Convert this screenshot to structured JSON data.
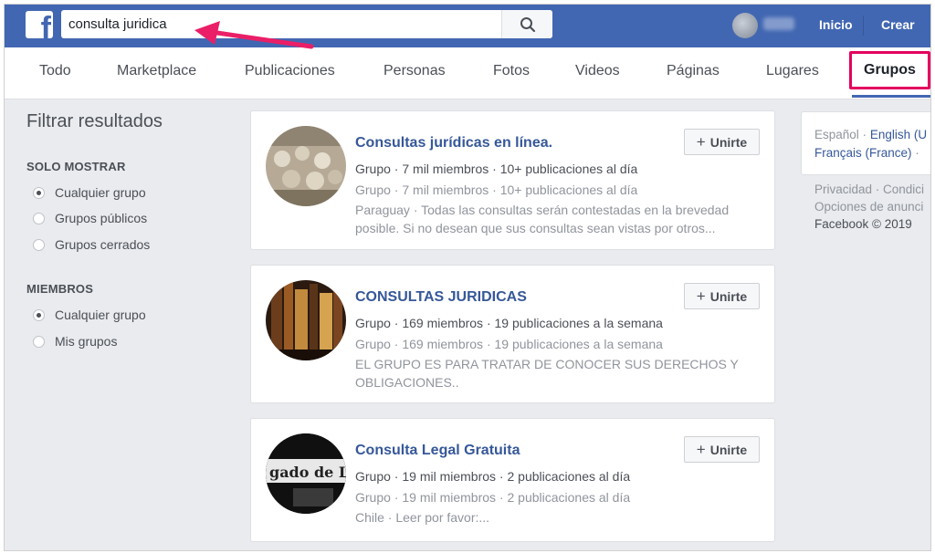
{
  "header": {
    "logo": "f",
    "search_value": "consulta juridica",
    "search_icon": "search-icon",
    "nav": {
      "home": "Inicio",
      "create": "Crear"
    }
  },
  "tabs": [
    {
      "label": "Todo"
    },
    {
      "label": "Marketplace"
    },
    {
      "label": "Publicaciones"
    },
    {
      "label": "Personas"
    },
    {
      "label": "Fotos"
    },
    {
      "label": "Videos"
    },
    {
      "label": "Páginas"
    },
    {
      "label": "Lugares"
    },
    {
      "label": "Grupos",
      "active": true
    }
  ],
  "filters": {
    "title": "Filtrar resultados",
    "show_only": {
      "heading": "SOLO MOSTRAR",
      "options": [
        "Cualquier grupo",
        "Grupos públicos",
        "Grupos cerrados"
      ],
      "selected": 0
    },
    "members": {
      "heading": "MIEMBROS",
      "options": [
        "Cualquier grupo",
        "Mis grupos"
      ],
      "selected": 0
    }
  },
  "results": [
    {
      "title": "Consultas jurídicas en línea.",
      "meta": "Grupo · 7 mil miembros · 10+ publicaciones al día",
      "meta2": "Grupo · 7 mil miembros · 10+ publicaciones al día",
      "desc": "Paraguay · Todas las consultas serán contestadas en la brevedad posible. Si no desean que sus consultas sean vistas por otros...",
      "join": "Unirte"
    },
    {
      "title": "CONSULTAS JURIDICAS",
      "meta": "Grupo · 169 miembros · 19 publicaciones a la semana",
      "meta2": "Grupo · 169 miembros · 19 publicaciones a la semana",
      "desc": "EL GRUPO ES PARA TRATAR DE CONOCER SUS DERECHOS Y OBLIGACIONES..",
      "join": "Unirte"
    },
    {
      "title": "Consulta Legal Gratuita",
      "meta": "Grupo · 19 mil miembros · 2 publicaciones al día",
      "meta2": "Grupo · 19 mil miembros · 2 publicaciones al día",
      "desc": "Chile · Leer por favor:...",
      "join": "Unirte",
      "image_text": "gado de L"
    }
  ],
  "languages": {
    "current": "Español",
    "sep": "·",
    "english": "English (U",
    "french": "Français (France)",
    "tail": "·"
  },
  "footer": {
    "line1": "Privacidad · Condici",
    "line2": "Opciones de anunci",
    "copyright": "Facebook © 2019"
  },
  "colors": {
    "brand": "#4267b2",
    "highlight": "#e4005f",
    "link": "#365899"
  }
}
